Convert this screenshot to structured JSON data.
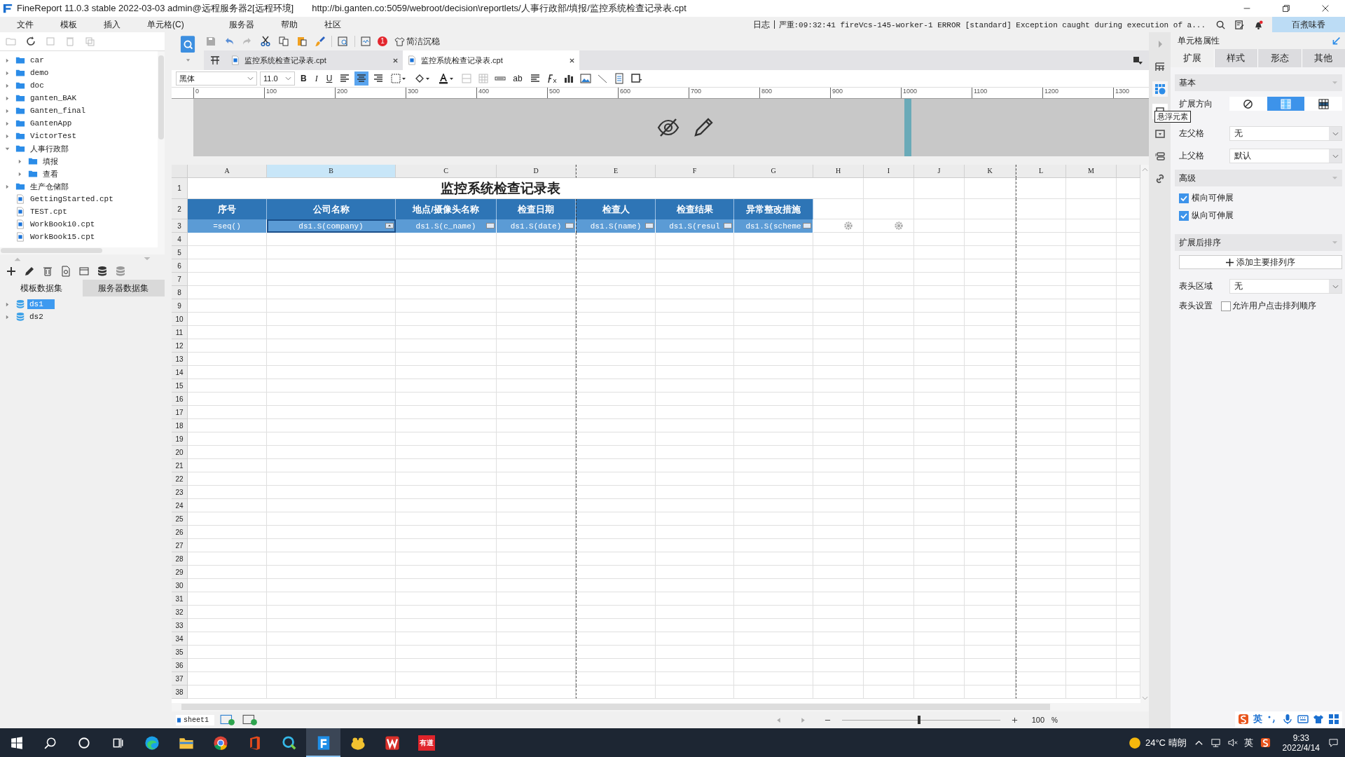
{
  "window": {
    "title": "FineReport 11.0.3 stable 2022-03-03 admin@远程服务器2[远程环境]",
    "url": "http://bi.ganten.co:5059/webroot/decision\\reportlets/人事行政部/填报/监控系统检查记录表.cpt"
  },
  "menu": [
    "文件",
    "模板",
    "插入",
    "单元格(C)",
    "服务器",
    "帮助",
    "社区"
  ],
  "log": {
    "label": "日志",
    "message": "严重:09:32:41 fireVcs-145-worker-1 ERROR [standard] Exception caught during execution of a..."
  },
  "user": "百煮味香",
  "file_tree": [
    {
      "name": "car",
      "kind": "folder",
      "expanded": false
    },
    {
      "name": "demo",
      "kind": "folder",
      "expanded": false
    },
    {
      "name": "doc",
      "kind": "folder",
      "expanded": false
    },
    {
      "name": "ganten_BAK",
      "kind": "folder",
      "expanded": false
    },
    {
      "name": "Ganten_final",
      "kind": "folder",
      "expanded": false
    },
    {
      "name": "GantenApp",
      "kind": "folder",
      "expanded": false
    },
    {
      "name": "VictorTest",
      "kind": "folder",
      "expanded": false
    },
    {
      "name": "人事行政部",
      "kind": "folder",
      "expanded": true,
      "children": [
        {
          "name": "填报",
          "kind": "folder",
          "expanded": false
        },
        {
          "name": "查看",
          "kind": "folder",
          "expanded": false
        }
      ]
    },
    {
      "name": "生产仓储部",
      "kind": "folder",
      "expanded": false
    },
    {
      "name": "GettingStarted.cpt",
      "kind": "file"
    },
    {
      "name": "TEST.cpt",
      "kind": "file"
    },
    {
      "name": "WorkBook10.cpt",
      "kind": "file"
    },
    {
      "name": "WorkBook15.cpt",
      "kind": "file"
    }
  ],
  "dataset_tabs": [
    {
      "label": "模板数据集",
      "selected": true
    },
    {
      "label": "服务器数据集",
      "selected": false
    }
  ],
  "datasets": [
    {
      "name": "ds1",
      "selected": true
    },
    {
      "name": "ds2",
      "selected": false
    }
  ],
  "toolbar": {
    "badge": "1",
    "theme": "简洁沉稳"
  },
  "tabs": [
    {
      "label": "监控系统检查记录表.cpt",
      "selected": false
    },
    {
      "label": "监控系统检查记录表.cpt",
      "selected": true
    }
  ],
  "format": {
    "font": "黑体",
    "size": "11.0",
    "bold": "B",
    "italic": "I",
    "underline": "U",
    "text_tool": "ab"
  },
  "ruler": [
    "0",
    "100",
    "200",
    "300",
    "400",
    "500",
    "600",
    "700",
    "800",
    "900",
    "1000",
    "1100",
    "1200",
    "1300"
  ],
  "sheet": {
    "columns": [
      {
        "label": "A",
        "selected": false
      },
      {
        "label": "B",
        "selected": true
      },
      {
        "label": "C",
        "selected": false
      },
      {
        "label": "D",
        "selected": false
      },
      {
        "label": "E",
        "selected": false
      },
      {
        "label": "F",
        "selected": false
      },
      {
        "label": "G",
        "selected": false
      },
      {
        "label": "H",
        "selected": false
      },
      {
        "label": "I",
        "selected": false
      },
      {
        "label": "J",
        "selected": false
      },
      {
        "label": "K",
        "selected": false
      },
      {
        "label": "L",
        "selected": false
      },
      {
        "label": "M",
        "selected": false
      }
    ],
    "rows": [
      "1",
      "2",
      "3",
      "4",
      "5",
      "6",
      "7",
      "8",
      "9",
      "10",
      "11",
      "12",
      "13",
      "14",
      "15",
      "16",
      "17",
      "18",
      "19",
      "20",
      "21",
      "22",
      "23",
      "24",
      "25",
      "26",
      "27",
      "28",
      "29",
      "30",
      "31",
      "32",
      "33",
      "34",
      "35",
      "36",
      "37",
      "38"
    ],
    "title": "监控系统检查记录表",
    "headers": [
      "序号",
      "公司名称",
      "地点/摄像头名称",
      "检查日期",
      "检查人",
      "检查结果",
      "异常整改措施"
    ],
    "formulas": [
      "=seq()",
      "ds1.S(company)",
      "ds1.S(c_name)",
      "ds1.S(date)",
      "ds1.S(name)",
      "ds1.S(resul",
      "ds1.S(scheme"
    ]
  },
  "sheet_tabs": [
    {
      "label": "sheet1",
      "selected": true
    }
  ],
  "zoom": {
    "level": 0.48,
    "value": "100",
    "unit": "%"
  },
  "properties": {
    "title": "单元格属性",
    "tabs": [
      {
        "label": "扩展",
        "selected": true
      },
      {
        "label": "样式",
        "selected": false
      },
      {
        "label": "形态",
        "selected": false
      },
      {
        "label": "其他",
        "selected": false
      }
    ],
    "basic": {
      "heading": "基本",
      "direction_label": "扩展方向",
      "directions": [
        {
          "kind": "none",
          "selected": false
        },
        {
          "kind": "vertical",
          "selected": true
        },
        {
          "kind": "horizontal",
          "selected": false
        }
      ],
      "left_parent": {
        "label": "左父格",
        "value": "无"
      },
      "top_parent": {
        "label": "上父格",
        "value": "默认"
      }
    },
    "advanced": {
      "heading": "高级",
      "options": [
        {
          "label": "横向可伸展",
          "checked": true
        },
        {
          "label": "纵向可伸展",
          "checked": true
        }
      ]
    },
    "sorting": {
      "heading": "扩展后排序",
      "button": "添加主要排列序"
    },
    "header_area": {
      "label": "表头区域",
      "value": "无"
    },
    "header_setting": {
      "label": "表头设置",
      "option": "允许用户点击排列顺序",
      "checked": false
    }
  },
  "tooltip": "悬浮元素",
  "ime": {
    "mode": "英"
  },
  "taskbar": {
    "apps": [
      {
        "kind": "edge",
        "active": false
      },
      {
        "kind": "explorer",
        "active": false
      },
      {
        "kind": "chrome",
        "active": false
      },
      {
        "kind": "office",
        "active": false
      },
      {
        "kind": "search-app",
        "active": false
      },
      {
        "kind": "finereport",
        "active": true
      },
      {
        "kind": "yellow-app",
        "active": false
      },
      {
        "kind": "wps",
        "active": false
      },
      {
        "kind": "youdao",
        "active": false,
        "label": "有道"
      }
    ],
    "weather": "24°C 晴朗",
    "ime": "英",
    "time": "9:33",
    "date": "2022/4/14"
  }
}
